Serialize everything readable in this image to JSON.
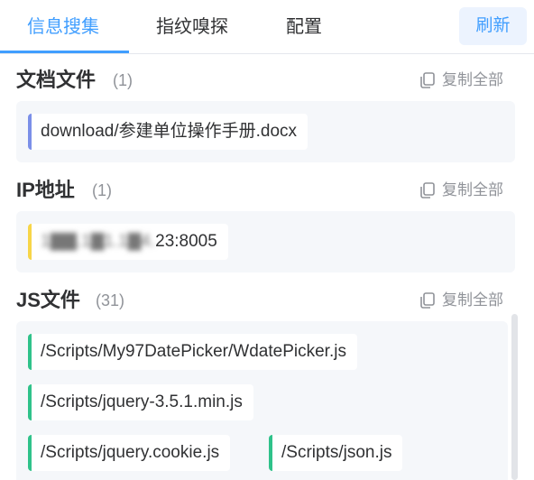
{
  "tabs": [
    {
      "label": "信息搜集"
    },
    {
      "label": "指纹嗅探"
    },
    {
      "label": "配置"
    }
  ],
  "refresh_label": "刷新",
  "copy_all_label": "复制全部",
  "sections": {
    "docs": {
      "title": "文档文件",
      "count": "(1)",
      "items": [
        "download/参建单位操作手册.docx"
      ]
    },
    "ip": {
      "title": "IP地址",
      "count": "(1)",
      "items": [
        {
          "masked": "1▇▇.1▇1.1▇4.",
          "visible": "23:8005"
        }
      ]
    },
    "js": {
      "title": "JS文件",
      "count": "(31)",
      "items": [
        "/Scripts/My97DatePicker/WdatePicker.js",
        "/Scripts/jquery-3.5.1.min.js",
        "/Scripts/jquery.cookie.js",
        "/Scripts/json.js"
      ]
    }
  },
  "colors": {
    "accent": "#409eff",
    "doc_bar": "#7b8fe8",
    "ip_bar": "#f7d548",
    "js_bar": "#2fc28a"
  },
  "icons": {
    "copy": "copy-icon"
  }
}
